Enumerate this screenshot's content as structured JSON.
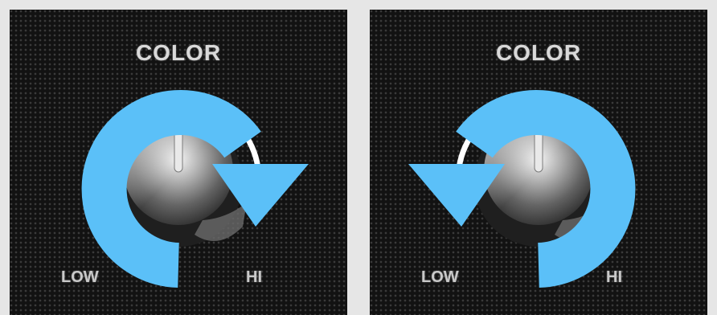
{
  "panels": [
    {
      "title": "COLOR",
      "low_label": "LOW",
      "hi_label": "HI",
      "arrow_icon": "rotate-clockwise-icon"
    },
    {
      "title": "COLOR",
      "low_label": "LOW",
      "hi_label": "HI",
      "arrow_icon": "rotate-counterclockwise-icon"
    }
  ],
  "colors": {
    "arrow": "#5bc0f8",
    "panel_background": "#121212",
    "page_background": "#e6e6e6"
  }
}
